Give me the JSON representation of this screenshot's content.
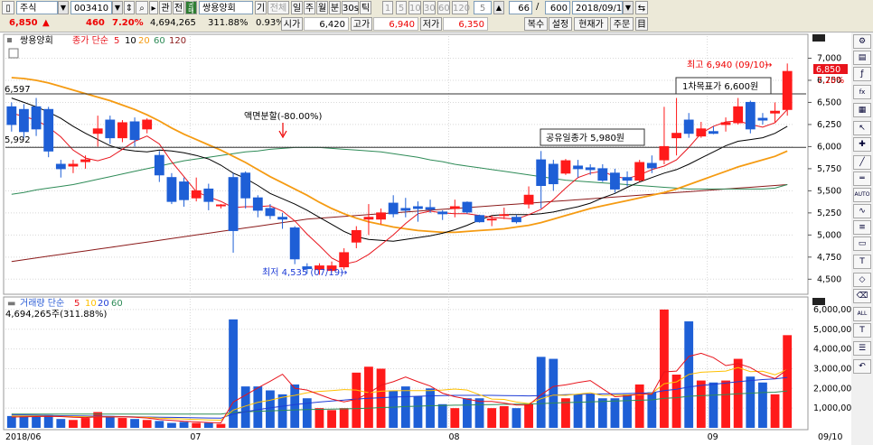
{
  "toolbar1": {
    "mode_label": "주식",
    "code": "003410",
    "corp_label": "관",
    "jeon_label": "전",
    "gong_label": "공매",
    "name": "쌍용양회",
    "gi_label": "기",
    "all_label": "전체",
    "periods": [
      "일",
      "주",
      "월",
      "분",
      "30s",
      "틱"
    ],
    "period_nums": [
      "1",
      "5",
      "10",
      "30",
      "60",
      "120"
    ],
    "count1": "5",
    "page_cur": "66",
    "page_sep": "/",
    "page_total": "600",
    "date": "2018/09/10"
  },
  "toolbar2": {
    "price": "6,850",
    "arrow": "▲",
    "change": "460",
    "pct": "7.20%",
    "volume": "4,694,265",
    "vol_pct": "311.88%",
    "turnover": "0.93%",
    "open_label": "시가",
    "open": "6,420",
    "high_label": "고가",
    "high": "6,940",
    "low_label": "저가",
    "low": "6,350",
    "btn_copy": "복수",
    "btn_setting": "설정",
    "btn_current": "현재가",
    "btn_order": "주문",
    "btn_last": "目"
  },
  "colors": {
    "up": "#ff1a1a",
    "down": "#1e5fd6",
    "ma5": "#e8141c",
    "ma10": "#000000",
    "ma20": "#f59b12",
    "ma60": "#2e8b57",
    "ma120": "#8b1a1a",
    "vol_ma5": "#e8141c",
    "vol_ma10": "#ffc000",
    "vol_ma20": "#1e3cd6",
    "vol_ma60": "#2e8b57"
  },
  "chart_data": {
    "type": "candlestick",
    "title": "쌍용양회",
    "legend": {
      "label": "종가 단순",
      "periods": [
        "5",
        "10",
        "20",
        "60",
        "120"
      ]
    },
    "ylim": [
      4350,
      7250
    ],
    "yticks": [
      "7,000",
      "6,750",
      "6,500",
      "6,250",
      "6,000",
      "5,750",
      "5,500",
      "5,250",
      "5,000",
      "4,750",
      "4,500"
    ],
    "ytick_values": [
      7000,
      6750,
      6500,
      6250,
      6000,
      5750,
      5500,
      5250,
      5000,
      4750,
      4500
    ],
    "xlabels": [
      "2018/06",
      "07",
      "08",
      "09",
      "09/10"
    ],
    "xlabel_index": [
      0,
      15,
      36,
      57,
      63
    ],
    "candles": [
      [
        6450,
        6500,
        6170,
        6250
      ],
      [
        6420,
        6480,
        6100,
        6170
      ],
      [
        6450,
        6550,
        6120,
        6200
      ],
      [
        6420,
        6450,
        5880,
        5950
      ],
      [
        5800,
        5850,
        5650,
        5750
      ],
      [
        5780,
        5850,
        5700,
        5800
      ],
      [
        5830,
        5900,
        5750,
        5850
      ],
      [
        6150,
        6350,
        6000,
        6200
      ],
      [
        6300,
        6350,
        6030,
        6100
      ],
      [
        6100,
        6300,
        6050,
        6270
      ],
      [
        6280,
        6330,
        6000,
        6080
      ],
      [
        6200,
        6320,
        6150,
        6300
      ],
      [
        5900,
        5950,
        5600,
        5680
      ],
      [
        5650,
        5700,
        5350,
        5380
      ],
      [
        5600,
        5650,
        5320,
        5400
      ],
      [
        5420,
        5650,
        5380,
        5500
      ],
      [
        5520,
        5580,
        5280,
        5380
      ],
      [
        5340,
        5350,
        5300,
        5340
      ],
      [
        5650,
        5700,
        4800,
        5050
      ],
      [
        5700,
        5720,
        5300,
        5420
      ],
      [
        5420,
        5450,
        5200,
        5280
      ],
      [
        5300,
        5350,
        5180,
        5220
      ],
      [
        5200,
        5250,
        5070,
        5180
      ],
      [
        5080,
        5100,
        4670,
        4730
      ],
      [
        4640,
        4680,
        4560,
        4620
      ],
      [
        4610,
        4680,
        4550,
        4650
      ],
      [
        4600,
        4700,
        4580,
        4650
      ],
      [
        4640,
        4850,
        4610,
        4800
      ],
      [
        4920,
        5100,
        4850,
        5050
      ],
      [
        5180,
        5350,
        5000,
        5200
      ],
      [
        5180,
        5300,
        5120,
        5250
      ],
      [
        5360,
        5450,
        5200,
        5240
      ],
      [
        5300,
        5420,
        5200,
        5280
      ],
      [
        5320,
        5380,
        5150,
        5300
      ],
      [
        5310,
        5400,
        5250,
        5290
      ],
      [
        5260,
        5280,
        5170,
        5240
      ],
      [
        5300,
        5400,
        5200,
        5320
      ],
      [
        5370,
        5380,
        5240,
        5260
      ],
      [
        5220,
        5230,
        5140,
        5150
      ],
      [
        5180,
        5220,
        5100,
        5180
      ],
      [
        5230,
        5310,
        5180,
        5230
      ],
      [
        5200,
        5230,
        5130,
        5150
      ],
      [
        5350,
        5550,
        5300,
        5450
      ],
      [
        5850,
        5950,
        5300,
        5560
      ],
      [
        5800,
        5850,
        5500,
        5580
      ],
      [
        5700,
        5860,
        5680,
        5840
      ],
      [
        5780,
        5850,
        5650,
        5750
      ],
      [
        5760,
        5800,
        5680,
        5740
      ],
      [
        5750,
        5800,
        5600,
        5620
      ],
      [
        5700,
        5750,
        5480,
        5520
      ],
      [
        5650,
        5720,
        5550,
        5620
      ],
      [
        5620,
        5850,
        5600,
        5820
      ],
      [
        5810,
        5900,
        5700,
        5760
      ],
      [
        5850,
        6450,
        5800,
        6000
      ],
      [
        6100,
        6550,
        5900,
        6150
      ],
      [
        6300,
        6380,
        6100,
        6150
      ],
      [
        6120,
        6280,
        6100,
        6200
      ],
      [
        6170,
        6230,
        6140,
        6150
      ],
      [
        6250,
        6330,
        6170,
        6270
      ],
      [
        6270,
        6550,
        6250,
        6450
      ],
      [
        6500,
        6520,
        6150,
        6200
      ],
      [
        6320,
        6380,
        6250,
        6300
      ],
      [
        6380,
        6500,
        6270,
        6400
      ],
      [
        6420,
        6940,
        6350,
        6850
      ]
    ],
    "ma5": [
      6380,
      6340,
      6300,
      6220,
      6110,
      5960,
      5870,
      5840,
      5880,
      5970,
      6060,
      6120,
      6030,
      5830,
      5660,
      5490,
      5430,
      5380,
      5310,
      5320,
      5320,
      5330,
      5270,
      5160,
      5010,
      4880,
      4740,
      4670,
      4700,
      4780,
      4890,
      5000,
      5130,
      5240,
      5270,
      5250,
      5240,
      5240,
      5220,
      5200,
      5190,
      5180,
      5230,
      5290,
      5400,
      5530,
      5650,
      5700,
      5720,
      5660,
      5640,
      5680,
      5740,
      5780,
      5850,
      5990,
      6150,
      6230,
      6280,
      6290,
      6250,
      6220,
      6270,
      6420
    ],
    "ma10": [
      6550,
      6500,
      6450,
      6390,
      6320,
      6230,
      6150,
      6080,
      6010,
      5970,
      5950,
      5940,
      5960,
      5950,
      5930,
      5900,
      5860,
      5790,
      5700,
      5640,
      5560,
      5470,
      5410,
      5350,
      5280,
      5200,
      5120,
      5040,
      4980,
      4950,
      4940,
      4930,
      4950,
      4970,
      4990,
      5020,
      5060,
      5110,
      5170,
      5220,
      5230,
      5230,
      5230,
      5240,
      5260,
      5290,
      5320,
      5360,
      5420,
      5470,
      5540,
      5600,
      5650,
      5700,
      5740,
      5800,
      5870,
      5940,
      6010,
      6060,
      6080,
      6100,
      6150,
      6230
    ],
    "ma20": [
      6780,
      6770,
      6750,
      6720,
      6680,
      6640,
      6600,
      6560,
      6520,
      6470,
      6420,
      6360,
      6290,
      6210,
      6140,
      6080,
      6020,
      5960,
      5890,
      5820,
      5740,
      5660,
      5590,
      5520,
      5450,
      5370,
      5300,
      5240,
      5190,
      5150,
      5120,
      5090,
      5070,
      5050,
      5040,
      5030,
      5030,
      5040,
      5050,
      5060,
      5070,
      5090,
      5110,
      5140,
      5180,
      5220,
      5260,
      5300,
      5330,
      5360,
      5390,
      5420,
      5450,
      5480,
      5520,
      5570,
      5620,
      5670,
      5720,
      5770,
      5810,
      5850,
      5890,
      5950
    ],
    "ma60": [
      5460,
      5480,
      5510,
      5530,
      5550,
      5570,
      5600,
      5630,
      5660,
      5690,
      5720,
      5750,
      5780,
      5810,
      5840,
      5860,
      5880,
      5900,
      5920,
      5940,
      5950,
      5970,
      5980,
      5990,
      5990,
      5990,
      5980,
      5970,
      5960,
      5950,
      5940,
      5920,
      5900,
      5880,
      5850,
      5830,
      5800,
      5780,
      5760,
      5740,
      5720,
      5700,
      5680,
      5660,
      5640,
      5620,
      5610,
      5600,
      5590,
      5580,
      5570,
      5560,
      5550,
      5540,
      5530,
      5520,
      5520,
      5520,
      5520,
      5520,
      5520,
      5520,
      5530,
      5570
    ],
    "ma120": [
      4700,
      4720,
      4740,
      4760,
      4780,
      4800,
      4820,
      4840,
      4860,
      4880,
      4900,
      4920,
      4940,
      4960,
      4980,
      5000,
      5020,
      5040,
      5060,
      5080,
      5100,
      5120,
      5140,
      5160,
      5180,
      5190,
      5200,
      5210,
      5220,
      5230,
      5240,
      5250,
      5260,
      5270,
      5280,
      5290,
      5300,
      5310,
      5320,
      5330,
      5340,
      5350,
      5360,
      5370,
      5380,
      5390,
      5400,
      5410,
      5420,
      5430,
      5440,
      5450,
      5460,
      5470,
      5480,
      5490,
      5500,
      5510,
      5520,
      5530,
      5540,
      5550,
      5560,
      5570
    ],
    "hlines": [
      {
        "value": 6597,
        "label": "6,597"
      },
      {
        "value": 5992,
        "label": "5,992"
      }
    ],
    "annotations": {
      "high": "최고 6,940 (09/10)",
      "low": "최저 4,535 (07/19)",
      "split": "액면분할(-80.00%)",
      "target": "1차목표가 6,600원",
      "gong": "공유일종가 5,980원",
      "last_tag": "6,850",
      "pct_tag": "7.20%"
    },
    "volume_legend": {
      "label": "거래량 단순",
      "periods": [
        "5",
        "10",
        "20",
        "60"
      ],
      "value": "4,694,265주(311.88%)"
    },
    "vol_ylim": [
      0,
      6500000
    ],
    "vol_yticks": [
      "6,000,000",
      "5,000,000",
      "4,000,000",
      "3,000,000",
      "2,000,000",
      "1,000,000"
    ],
    "vol_ytick_values": [
      6000000,
      5000000,
      4000000,
      3000000,
      2000000,
      1000000
    ],
    "volumes": [
      600000,
      600000,
      550000,
      650000,
      450000,
      400000,
      500000,
      800000,
      600000,
      500000,
      450000,
      400000,
      350000,
      250000,
      300000,
      250000,
      250000,
      200000,
      5500000,
      2100000,
      2100000,
      1900000,
      1700000,
      2200000,
      1500000,
      1000000,
      900000,
      1000000,
      2800000,
      3100000,
      3000000,
      1900000,
      2100000,
      1600000,
      2000000,
      1200000,
      1000000,
      1500000,
      1500000,
      1000000,
      1100000,
      1000000,
      1200000,
      3600000,
      3500000,
      1500000,
      1700000,
      1700000,
      1500000,
      1500000,
      1700000,
      2200000,
      1800000,
      6000000,
      2700000,
      5400000,
      2400000,
      2300000,
      2400000,
      3500000,
      2600000,
      2300000,
      1700000,
      4700000
    ],
    "vol_ma5": [
      550000,
      560000,
      570000,
      580000,
      570000,
      540000,
      520000,
      560000,
      550000,
      560000,
      540000,
      500000,
      420000,
      380000,
      330000,
      300000,
      270000,
      250000,
      1310000,
      1660000,
      2030000,
      2360000,
      2720000,
      2010000,
      1920000,
      1690000,
      1460000,
      1320000,
      1440000,
      1760000,
      2160000,
      2340000,
      2580000,
      2340000,
      2120000,
      1760000,
      1580000,
      1460000,
      1340000,
      1340000,
      1260000,
      1160000,
      1160000,
      1680000,
      2100000,
      2180000,
      2300000,
      2400000,
      1980000,
      1580000,
      1620000,
      1720000,
      1700000,
      2840000,
      2880000,
      3620000,
      3780000,
      3560000,
      3160000,
      3260000,
      3060000,
      2700000,
      2500000,
      2960000
    ],
    "vol_ma10": [
      600000,
      600000,
      600000,
      590000,
      580000,
      570000,
      560000,
      560000,
      560000,
      560000,
      550000,
      530000,
      490000,
      470000,
      450000,
      420000,
      400000,
      390000,
      900000,
      1110000,
      1290000,
      1400000,
      1550000,
      1650000,
      1780000,
      1850000,
      1890000,
      1940000,
      1920000,
      1780000,
      1860000,
      1880000,
      1890000,
      1890000,
      1890000,
      1920000,
      1970000,
      1920000,
      1680000,
      1460000,
      1440000,
      1310000,
      1230000,
      1480000,
      1660000,
      1650000,
      1710000,
      1780000,
      1640000,
      1660000,
      1670000,
      1680000,
      1750000,
      2240000,
      2330000,
      2710000,
      2820000,
      2850000,
      2880000,
      3060000,
      2850000,
      2870000,
      2690000,
      2960000
    ],
    "vol_ma20": [
      650000,
      650000,
      640000,
      630000,
      620000,
      610000,
      600000,
      590000,
      580000,
      570000,
      560000,
      550000,
      540000,
      530000,
      520000,
      510000,
      500000,
      490000,
      700000,
      820000,
      920000,
      1010000,
      1100000,
      1180000,
      1250000,
      1310000,
      1360000,
      1410000,
      1460000,
      1500000,
      1530000,
      1560000,
      1580000,
      1600000,
      1620000,
      1640000,
      1650000,
      1650000,
      1650000,
      1650000,
      1640000,
      1630000,
      1620000,
      1640000,
      1660000,
      1680000,
      1700000,
      1710000,
      1720000,
      1730000,
      1740000,
      1760000,
      1780000,
      1890000,
      1960000,
      2070000,
      2150000,
      2210000,
      2270000,
      2340000,
      2400000,
      2450000,
      2480000,
      2560000
    ],
    "vol_ma60": [
      700000,
      700000,
      700000,
      700000,
      700000,
      700000,
      700000,
      700000,
      700000,
      700000,
      700000,
      700000,
      700000,
      700000,
      700000,
      700000,
      700000,
      700000,
      780000,
      810000,
      840000,
      860000,
      890000,
      910000,
      930000,
      940000,
      950000,
      960000,
      980000,
      1000000,
      1030000,
      1050000,
      1080000,
      1100000,
      1120000,
      1130000,
      1150000,
      1160000,
      1170000,
      1180000,
      1190000,
      1200000,
      1210000,
      1230000,
      1260000,
      1280000,
      1300000,
      1320000,
      1340000,
      1360000,
      1380000,
      1400000,
      1420000,
      1500000,
      1530000,
      1600000,
      1630000,
      1660000,
      1690000,
      1730000,
      1760000,
      1790000,
      1810000,
      1870000
    ]
  }
}
